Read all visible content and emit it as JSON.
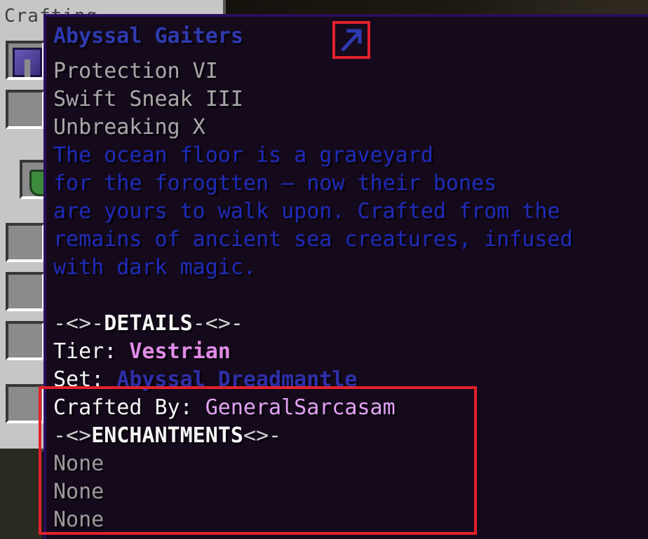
{
  "background": {
    "inventory_title": "Crafting"
  },
  "tooltip": {
    "item_name": "Abyssal Gaiters",
    "enchantments": [
      "Protection VI",
      "Swift Sneak III",
      "Unbreaking X"
    ],
    "lore": [
      "The ocean floor is a graveyard",
      "for the forogtten — now their bones",
      "are yours to walk upon. Crafted from the",
      "remains of ancient sea creatures, infused",
      "with dark magic."
    ],
    "details_header": {
      "left_ornament": "-<>-",
      "title": "DETAILS",
      "right_ornament": "-<>-"
    },
    "tier_label": "Tier: ",
    "tier_value": "Vestrian",
    "set_label": "Set: ",
    "set_value": "Abyssal Dreadmantle",
    "crafted_by_label": "Crafted By: ",
    "crafted_by_value": "GeneralSarcasam",
    "enchant_header": {
      "left_ornament": "-<>",
      "title": "ENCHANTMENTS",
      "right_ornament": "<>-"
    },
    "enchant_slots": [
      "None",
      "None",
      "None"
    ]
  },
  "colors": {
    "highlight": "#e2212a",
    "tooltip_bg": "#150a1c",
    "tooltip_border": "#2a0e5c",
    "name": "#2e3ab0",
    "lore": "#1f2bb8",
    "tier": "#e18be6",
    "crafter": "#e2a2f3"
  },
  "icons": {
    "external_link": "arrow-up-right-icon",
    "armor_item": "leggings-icon",
    "shield_item": "shield-icon"
  }
}
